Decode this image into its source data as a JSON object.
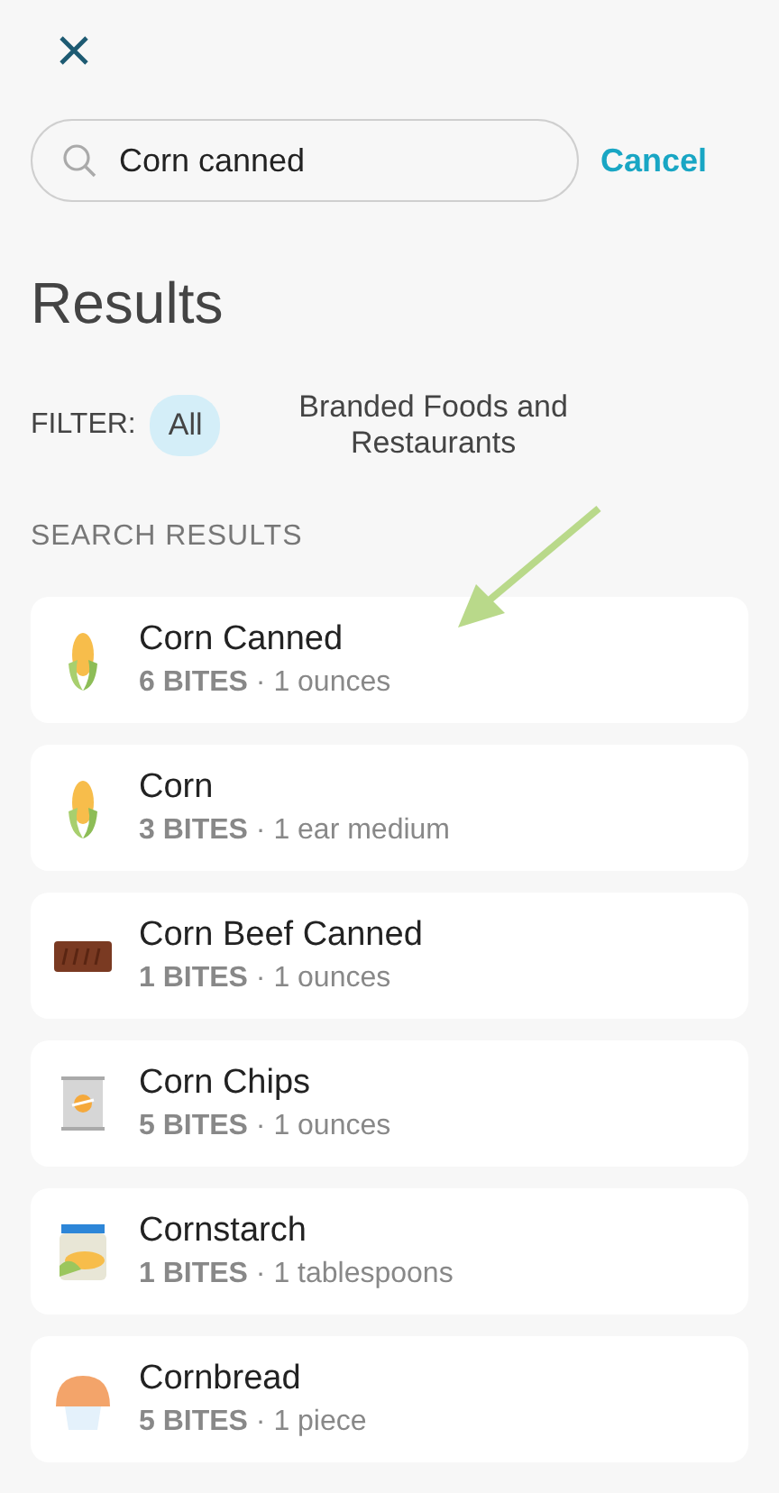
{
  "search": {
    "value": "Corn canned",
    "cancel": "Cancel"
  },
  "title": "Results",
  "filter": {
    "label": "FILTER:",
    "options": [
      {
        "label": "All",
        "selected": true
      },
      {
        "label": "Branded Foods and Restaurants",
        "selected": false
      }
    ]
  },
  "section_label": "SEARCH RESULTS",
  "results": [
    {
      "name": "Corn Canned",
      "detail": "**6 BITES** · 1 ounces",
      "kind": "corn"
    },
    {
      "name": "Corn",
      "detail": "**3 BITES** · 1 ear medium",
      "kind": "corn"
    },
    {
      "name": "Corn Beef Canned",
      "detail": "**1 BITES** · 1 ounces",
      "kind": "beef"
    },
    {
      "name": "Corn Chips",
      "detail": "**5 BITES** · 1 ounces",
      "kind": "can"
    },
    {
      "name": "Cornstarch",
      "detail": "**1 BITES** · 1 tablespoons",
      "kind": "jar"
    },
    {
      "name": "Cornbread",
      "detail": "**5 BITES** · 1 piece",
      "kind": "muffin"
    }
  ]
}
